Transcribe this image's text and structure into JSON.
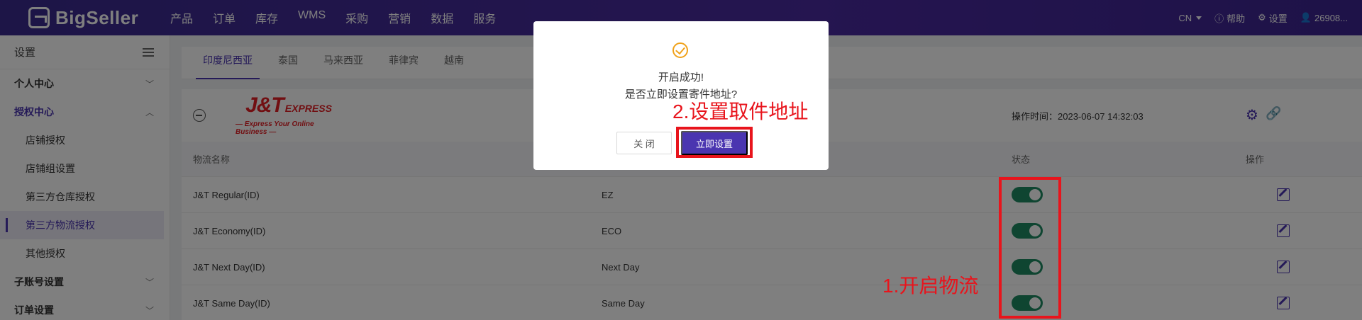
{
  "topnav": {
    "logo": "BigSeller",
    "menu": [
      "产品",
      "订单",
      "库存",
      "WMS",
      "采购",
      "营销",
      "数据",
      "服务"
    ],
    "lang": "CN",
    "help": "帮助",
    "settings": "设置",
    "user": "26908..."
  },
  "sidebar": {
    "title": "设置",
    "groups": [
      {
        "label": "个人中心"
      },
      {
        "label": "授权中心"
      },
      {
        "label": "子账号设置"
      },
      {
        "label": "订单设置"
      }
    ],
    "items": [
      "店铺授权",
      "店铺组设置",
      "第三方仓库授权",
      "第三方物流授权",
      "其他授权"
    ]
  },
  "tabs": [
    "印度尼西亚",
    "泰国",
    "马来西亚",
    "菲律宾",
    "越南"
  ],
  "carrier": {
    "logo_main": "J&T",
    "logo_express": "EXPRESS",
    "logo_tagline": "— Express Your Online Business —",
    "op_time": "操作时间：2023-06-07 14:32:03"
  },
  "table": {
    "headers": [
      "物流名称",
      "状态",
      "操作"
    ],
    "rows": [
      {
        "name": "J&T Regular(ID)",
        "code": "EZ"
      },
      {
        "name": "J&T Economy(ID)",
        "code": "ECO"
      },
      {
        "name": "J&T Next Day(ID)",
        "code": "Next Day"
      },
      {
        "name": "J&T Same Day(ID)",
        "code": "Same Day"
      }
    ]
  },
  "modal": {
    "line1": "开启成功!",
    "line2": "是否立即设置寄件地址?",
    "close": "关 闭",
    "confirm": "立即设置"
  },
  "annotations": {
    "step2": "2.设置取件地址",
    "step1": "1.开启物流"
  },
  "colors": {
    "brand": "#4a35b0",
    "toggle_on": "#1f8a63",
    "annotation_red": "#e8141c",
    "jt_red": "#e31e24"
  }
}
